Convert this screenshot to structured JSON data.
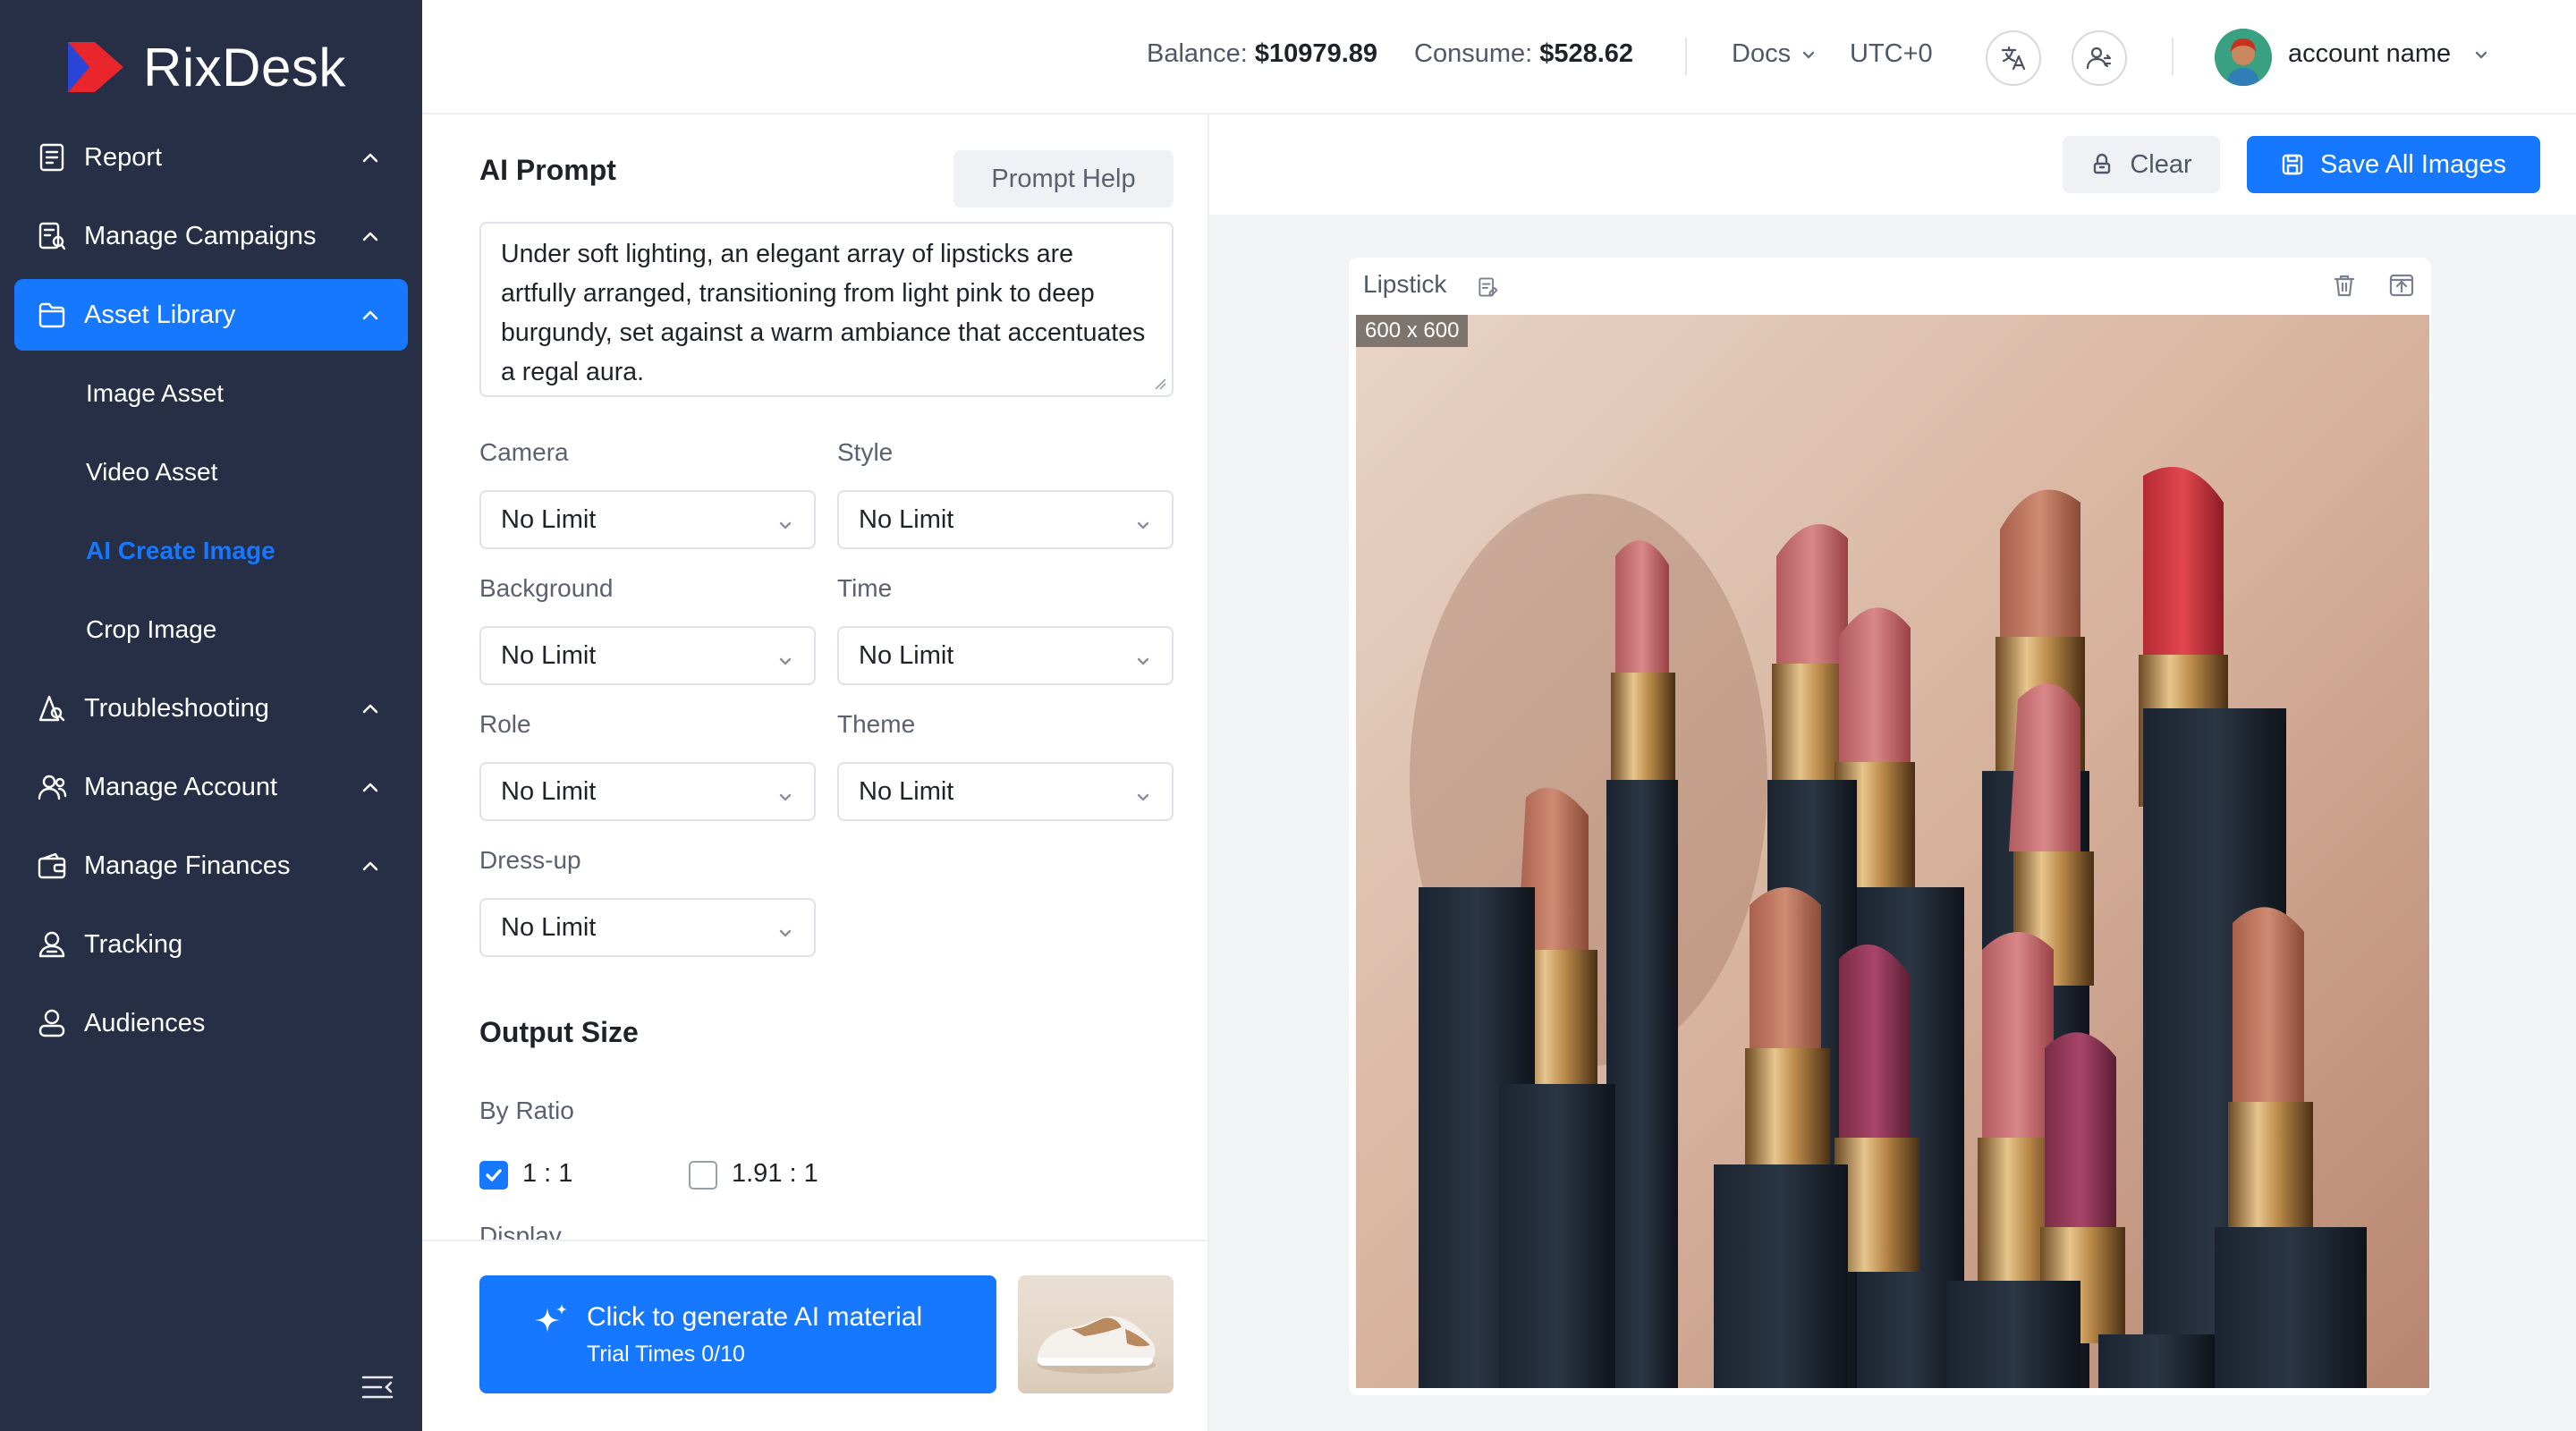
{
  "app": {
    "name": "RixDesk"
  },
  "header": {
    "balance_label": "Balance:",
    "balance_value": "$10979.89",
    "consume_label": "Consume:",
    "consume_value": "$528.62",
    "docs_label": "Docs",
    "timezone": "UTC+0",
    "account_name": "account name"
  },
  "sidebar": {
    "items": [
      {
        "label": "Report",
        "icon": "report-icon"
      },
      {
        "label": "Manage Campaigns",
        "icon": "campaign-icon"
      },
      {
        "label": "Asset Library",
        "icon": "folder-icon",
        "active": true
      },
      {
        "label": "Troubleshooting",
        "icon": "troubleshoot-icon"
      },
      {
        "label": "Manage Account",
        "icon": "account-icon"
      },
      {
        "label": "Manage Finances",
        "icon": "wallet-icon"
      },
      {
        "label": "Tracking",
        "icon": "tracking-icon"
      },
      {
        "label": "Audiences",
        "icon": "audience-icon"
      }
    ],
    "sub_items": [
      {
        "label": "Image Asset"
      },
      {
        "label": "Video Asset"
      },
      {
        "label": "AI Create Image",
        "active": true
      },
      {
        "label": "Crop Image"
      }
    ]
  },
  "prompt": {
    "title": "AI Prompt",
    "help_button": "Prompt Help",
    "text": "Under soft lighting, an elegant array of lipsticks are artfully arranged, transitioning from light pink to deep burgundy, set against a warm ambiance that accentuates a regal aura."
  },
  "options": {
    "camera": {
      "label": "Camera",
      "value": "No Limit"
    },
    "style": {
      "label": "Style",
      "value": "No Limit"
    },
    "background": {
      "label": "Background",
      "value": "No Limit"
    },
    "time": {
      "label": "Time",
      "value": "No Limit"
    },
    "role": {
      "label": "Role",
      "value": "No Limit"
    },
    "theme": {
      "label": "Theme",
      "value": "No Limit"
    },
    "dressup": {
      "label": "Dress-up",
      "value": "No Limit"
    }
  },
  "output": {
    "title": "Output Size",
    "by_ratio_label": "By Ratio",
    "ratio_1": {
      "label": "1 : 1",
      "checked": true
    },
    "ratio_2": {
      "label": "1.91 : 1",
      "checked": false
    },
    "cut_label": "Display"
  },
  "generate": {
    "title": "Click to generate AI material",
    "subtitle": "Trial Times 0/10"
  },
  "actions": {
    "clear": "Clear",
    "save_all": "Save All Images"
  },
  "result": {
    "title": "Lipstick",
    "size_badge": "600 x 600"
  },
  "colors": {
    "sidebar_bg": "#262f45",
    "accent": "#1677ff",
    "canvas_bg": "#f2f3f5"
  }
}
